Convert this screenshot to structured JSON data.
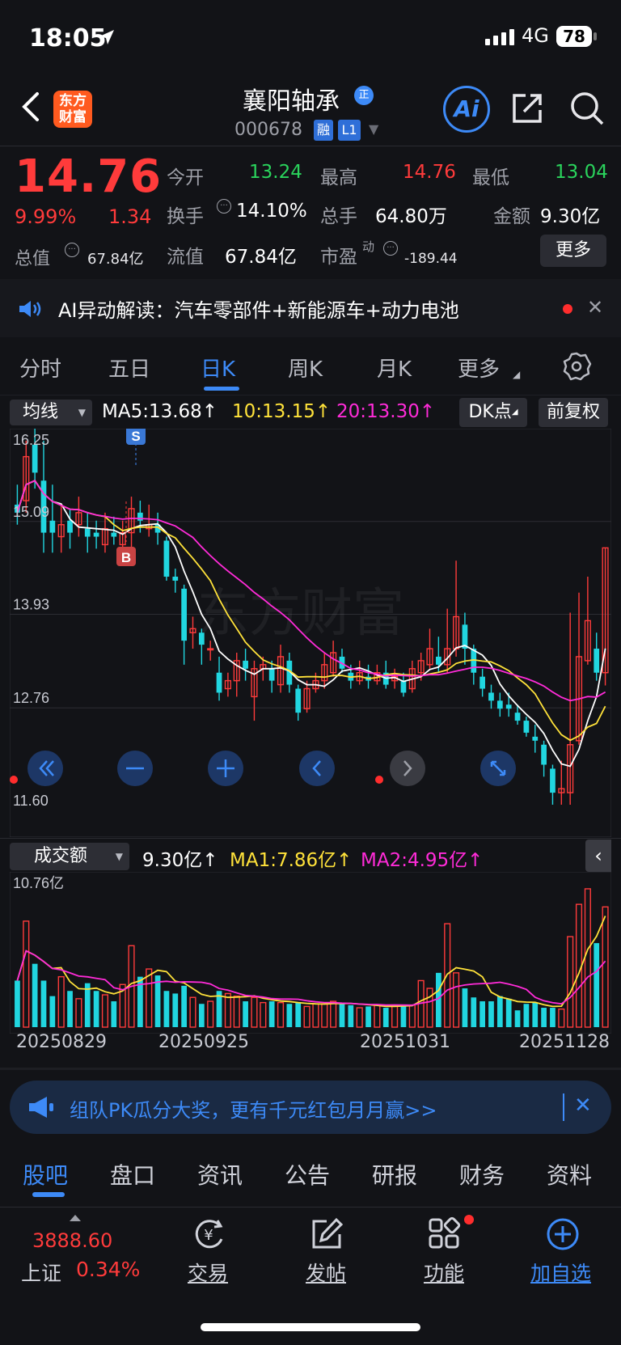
{
  "status_bar": {
    "time": "18:05",
    "network": "4G",
    "battery": "78"
  },
  "header": {
    "logo_line1": "东方",
    "logo_line2": "财富",
    "stock_name": "襄阳轴承",
    "tag_zheng": "正",
    "stock_code": "000678",
    "tag_rong": "融",
    "tag_l1": "L1",
    "ai_label": "Ai"
  },
  "quote": {
    "price": "14.76",
    "change_pct": "9.99%",
    "change": "1.34",
    "open_label": "今开",
    "open": "13.24",
    "high_label": "最高",
    "high": "14.76",
    "low_label": "最低",
    "low": "13.04",
    "turnover_label": "换手",
    "turnover": "14.10%",
    "volume_label": "总手",
    "volume": "64.80万",
    "amount_label": "金额",
    "amount": "9.30亿",
    "total_cap_label": "总值",
    "total_cap": "67.84亿",
    "float_cap_label": "流值",
    "float_cap": "67.84亿",
    "pe_label": "市盈",
    "pe_sup": "动",
    "pe": "-189.44",
    "more_label": "更多"
  },
  "ai_strip": {
    "text": "AI异动解读：汽车零部件+新能源车+动力电池"
  },
  "kline_tabs": [
    "分时",
    "五日",
    "日K",
    "周K",
    "月K",
    "更多"
  ],
  "indicators": {
    "ma_select": "均线",
    "ma5": "MA5:13.68↑",
    "ma10": "10:13.15↑",
    "ma20": "20:13.30↑",
    "dk_label": "DK点",
    "fq_label": "前复权"
  },
  "kchart": {
    "y_labels": [
      "16.25",
      "15.09",
      "13.93",
      "12.76",
      "11.60"
    ],
    "signal_s": "S",
    "signal_b": "B",
    "watermark": "东方财富"
  },
  "volume": {
    "select": "成交额",
    "value": "9.30亿↑",
    "ma1": "MA1:7.86亿↑",
    "ma2": "MA2:4.95亿↑",
    "max_label": "10.76亿",
    "dates": [
      "20250829",
      "20250925",
      "20251031",
      "20251128"
    ]
  },
  "chart_data": {
    "type": "candlestick",
    "ylim": [
      11.6,
      16.25
    ],
    "y_ticks": [
      16.25,
      15.09,
      13.93,
      12.76,
      11.6
    ],
    "x_tick_labels": [
      "20250829",
      "20250925",
      "20251031",
      "20251128"
    ],
    "series_names": [
      "MA5",
      "MA10",
      "MA20"
    ],
    "candles": [
      [
        15.3,
        15.2,
        15.55,
        15.05
      ],
      [
        15.35,
        15.9,
        16.1,
        15.2
      ],
      [
        16.05,
        15.7,
        16.25,
        15.5
      ],
      [
        15.6,
        14.95,
        16.1,
        14.7
      ],
      [
        15.1,
        14.95,
        15.55,
        14.7
      ],
      [
        14.9,
        15.05,
        15.3,
        14.7
      ],
      [
        15.1,
        14.95,
        15.25,
        14.75
      ],
      [
        15.05,
        15.2,
        15.4,
        14.9
      ],
      [
        15.0,
        14.9,
        15.2,
        14.7
      ],
      [
        14.95,
        14.9,
        15.1,
        14.75
      ],
      [
        14.8,
        15.0,
        15.2,
        14.7
      ],
      [
        14.95,
        14.9,
        15.15,
        14.8
      ],
      [
        14.8,
        14.95,
        15.1,
        14.7
      ],
      [
        14.95,
        15.25,
        15.4,
        14.75
      ],
      [
        15.2,
        15.1,
        15.35,
        14.95
      ],
      [
        15.0,
        15.05,
        15.3,
        14.9
      ],
      [
        15.05,
        14.95,
        15.2,
        14.8
      ],
      [
        14.85,
        14.4,
        14.9,
        14.35
      ],
      [
        14.4,
        14.35,
        14.5,
        14.2
      ],
      [
        14.25,
        13.6,
        14.3,
        13.3
      ],
      [
        13.7,
        13.75,
        13.9,
        13.5
      ],
      [
        13.7,
        13.55,
        13.75,
        13.3
      ],
      [
        13.5,
        13.5,
        13.6,
        13.35
      ],
      [
        13.2,
        12.95,
        13.4,
        12.85
      ],
      [
        13.0,
        13.1,
        13.2,
        12.9
      ],
      [
        13.1,
        13.35,
        13.45,
        12.9
      ],
      [
        13.35,
        13.25,
        13.5,
        13.1
      ],
      [
        12.9,
        13.25,
        13.35,
        12.6
      ],
      [
        13.25,
        13.3,
        13.4,
        13.1
      ],
      [
        13.25,
        13.1,
        13.35,
        12.95
      ],
      [
        13.05,
        13.4,
        13.55,
        12.95
      ],
      [
        13.35,
        13.05,
        13.45,
        12.95
      ],
      [
        13.0,
        12.7,
        13.05,
        12.6
      ],
      [
        12.75,
        13.0,
        13.1,
        12.7
      ],
      [
        13.0,
        13.1,
        13.2,
        12.95
      ],
      [
        13.1,
        13.3,
        13.45,
        13.0
      ],
      [
        13.2,
        13.45,
        13.6,
        13.15
      ],
      [
        13.4,
        13.25,
        13.5,
        13.2
      ],
      [
        13.2,
        13.1,
        13.3,
        13.0
      ],
      [
        13.1,
        13.2,
        13.35,
        13.05
      ],
      [
        13.15,
        13.1,
        13.3,
        13.0
      ],
      [
        13.1,
        13.2,
        13.3,
        13.05
      ],
      [
        13.2,
        13.05,
        13.35,
        13.0
      ],
      [
        13.1,
        13.15,
        13.25,
        13.0
      ],
      [
        13.1,
        12.95,
        13.2,
        12.9
      ],
      [
        13.0,
        13.25,
        13.35,
        12.95
      ],
      [
        13.2,
        13.35,
        13.45,
        13.1
      ],
      [
        13.3,
        13.5,
        13.75,
        13.25
      ],
      [
        13.4,
        13.3,
        13.65,
        13.2
      ],
      [
        13.3,
        13.5,
        14.0,
        13.2
      ],
      [
        13.5,
        13.9,
        14.6,
        13.4
      ],
      [
        13.8,
        13.5,
        13.95,
        13.3
      ],
      [
        13.5,
        13.2,
        13.55,
        13.05
      ],
      [
        13.15,
        13.0,
        13.25,
        12.9
      ],
      [
        12.95,
        12.85,
        13.05,
        12.75
      ],
      [
        12.85,
        12.75,
        12.95,
        12.65
      ],
      [
        12.8,
        12.75,
        12.95,
        12.65
      ],
      [
        12.7,
        12.6,
        12.8,
        12.55
      ],
      [
        12.6,
        12.45,
        12.65,
        12.4
      ],
      [
        12.4,
        12.35,
        12.55,
        12.2
      ],
      [
        12.3,
        12.05,
        12.35,
        11.9
      ],
      [
        12.0,
        11.7,
        12.05,
        11.55
      ],
      [
        11.7,
        11.75,
        12.1,
        11.55
      ],
      [
        11.7,
        12.3,
        13.95,
        11.55
      ],
      [
        12.35,
        13.4,
        14.2,
        12.3
      ],
      [
        13.35,
        13.85,
        14.4,
        13.3
      ],
      [
        13.5,
        13.2,
        13.7,
        13.1
      ],
      [
        13.2,
        14.76,
        14.76,
        13.04
      ]
    ],
    "volume": [
      3.6,
      8.2,
      4.9,
      3.6,
      2.4,
      3.9,
      2.8,
      2.2,
      3.4,
      2.8,
      2.5,
      2.0,
      3.3,
      6.3,
      3.9,
      4.5,
      4.0,
      2.8,
      2.6,
      3.2,
      2.3,
      1.8,
      2.0,
      2.8,
      2.6,
      2.4,
      2.0,
      2.3,
      1.9,
      2.0,
      1.9,
      1.8,
      1.9,
      1.6,
      1.8,
      1.8,
      2.0,
      1.9,
      1.7,
      1.5,
      1.6,
      1.7,
      1.5,
      1.7,
      1.7,
      1.7,
      3.6,
      3.0,
      4.2,
      8.0,
      4.2,
      3.0,
      2.3,
      2.0,
      2.0,
      2.4,
      2.2,
      1.3,
      1.8,
      1.9,
      1.5,
      1.5,
      1.4,
      7.0,
      9.5,
      10.7,
      6.5,
      9.3
    ]
  }
}
